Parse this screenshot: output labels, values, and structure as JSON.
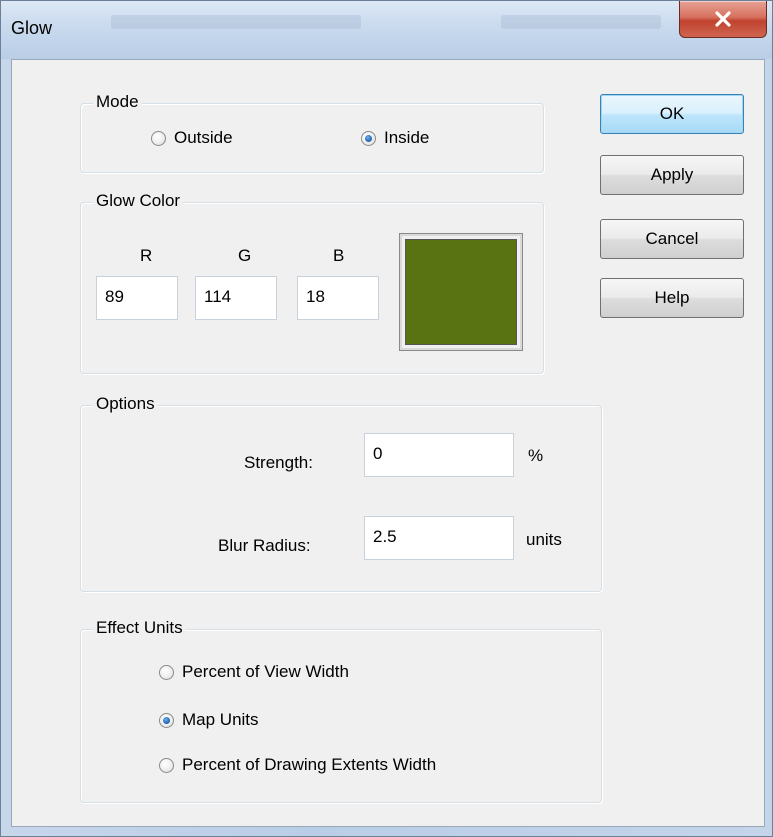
{
  "window": {
    "title": "Glow"
  },
  "mode": {
    "label": "Mode",
    "options": [
      {
        "label": "Outside",
        "checked": false
      },
      {
        "label": "Inside",
        "checked": true
      }
    ]
  },
  "glow_color": {
    "label": "Glow Color",
    "r_label": "R",
    "g_label": "G",
    "b_label": "B",
    "r": "89",
    "g": "114",
    "b": "18",
    "swatch_color": "#597212"
  },
  "options": {
    "label": "Options",
    "strength_label": "Strength:",
    "strength_value": "0",
    "strength_unit": "%",
    "blur_label": "Blur Radius:",
    "blur_value": "2.5",
    "blur_unit": "units"
  },
  "effect_units": {
    "label": "Effect Units",
    "options": [
      {
        "label": "Percent of View Width",
        "checked": false
      },
      {
        "label": "Map Units",
        "checked": true
      },
      {
        "label": "Percent of Drawing Extents Width",
        "checked": false
      }
    ]
  },
  "buttons": {
    "ok": "OK",
    "apply": "Apply",
    "cancel": "Cancel",
    "help": "Help"
  },
  "icons": {
    "close": "close-x-icon"
  },
  "colors": {
    "default_button_border": "#3c7fb1",
    "close_button": "#c0432f"
  }
}
